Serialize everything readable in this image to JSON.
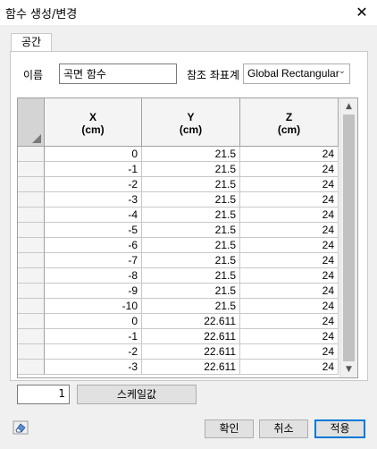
{
  "window": {
    "title": "함수 생성/변경",
    "close_glyph": "✕"
  },
  "tab": {
    "label": "공간"
  },
  "name_field": {
    "label": "이름",
    "value": "곡면 함수"
  },
  "coord_system": {
    "label": "참조 좌표계",
    "selected": "Global Rectangular"
  },
  "table": {
    "columns": [
      {
        "name": "X",
        "unit": "(cm)"
      },
      {
        "name": "Y",
        "unit": "(cm)"
      },
      {
        "name": "Z",
        "unit": "(cm)"
      }
    ],
    "rows": [
      [
        "0",
        "21.5",
        "24"
      ],
      [
        "-1",
        "21.5",
        "24"
      ],
      [
        "-2",
        "21.5",
        "24"
      ],
      [
        "-3",
        "21.5",
        "24"
      ],
      [
        "-4",
        "21.5",
        "24"
      ],
      [
        "-5",
        "21.5",
        "24"
      ],
      [
        "-6",
        "21.5",
        "24"
      ],
      [
        "-7",
        "21.5",
        "24"
      ],
      [
        "-8",
        "21.5",
        "24"
      ],
      [
        "-9",
        "21.5",
        "24"
      ],
      [
        "-10",
        "21.5",
        "24"
      ],
      [
        "0",
        "22.611",
        "24"
      ],
      [
        "-1",
        "22.611",
        "24"
      ],
      [
        "-2",
        "22.611",
        "24"
      ],
      [
        "-3",
        "22.611",
        "24"
      ]
    ]
  },
  "scale": {
    "value": "1",
    "button_label": "스케일값"
  },
  "buttons": {
    "ok": "확인",
    "cancel": "취소",
    "apply": "적용"
  }
}
